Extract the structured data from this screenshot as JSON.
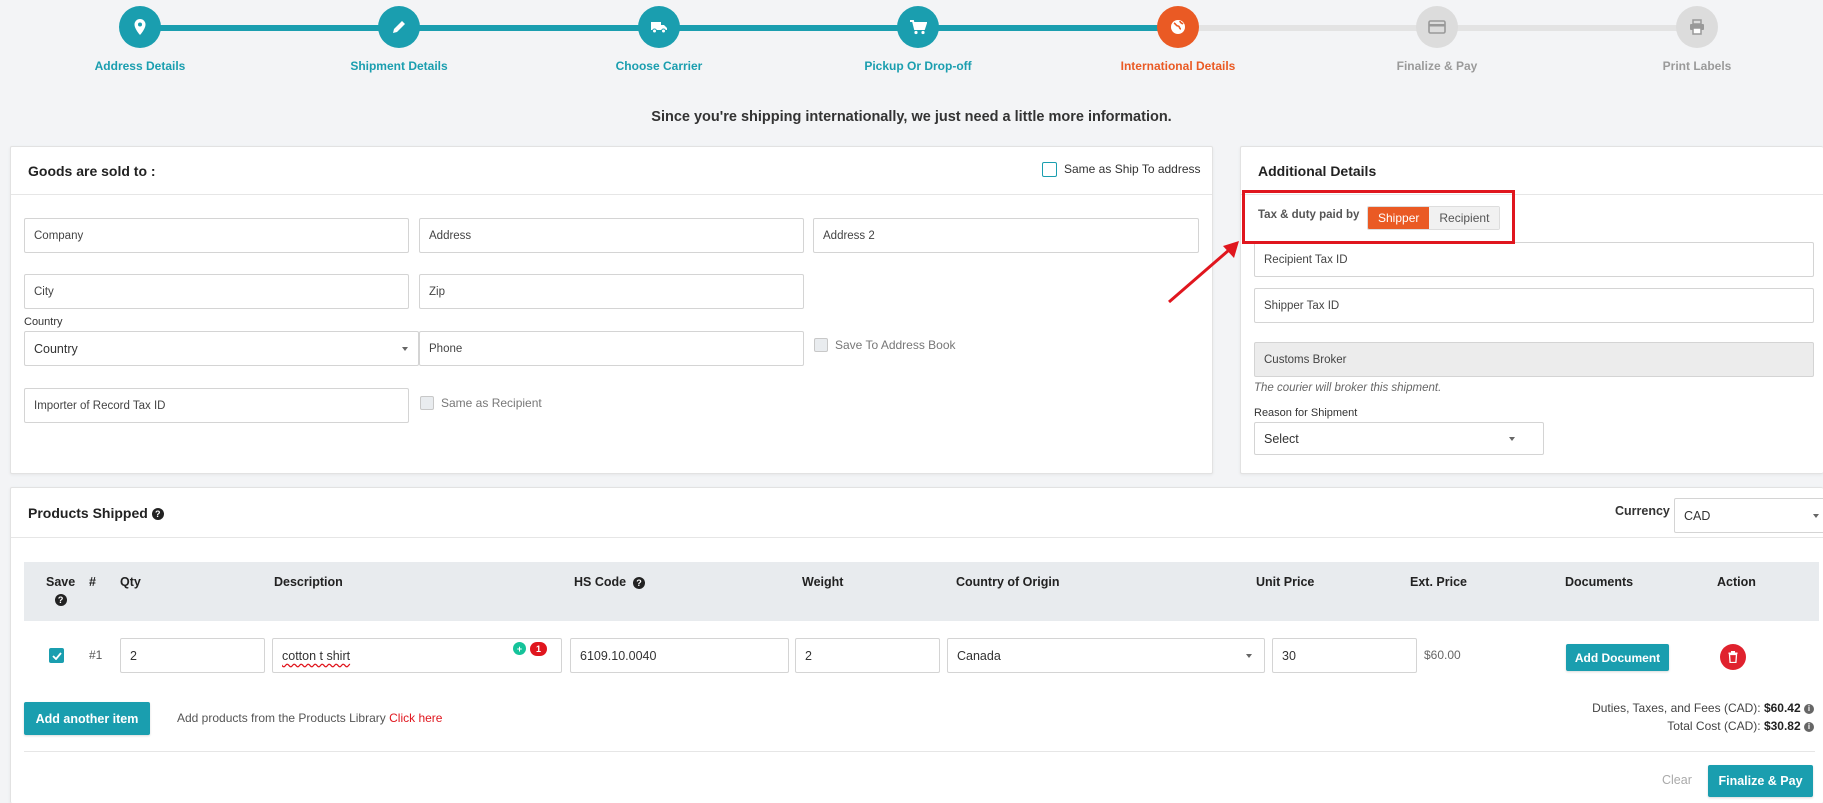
{
  "stepper": {
    "steps": [
      {
        "label": "Address Details"
      },
      {
        "label": "Shipment Details"
      },
      {
        "label": "Choose Carrier"
      },
      {
        "label": "Pickup Or Drop-off"
      },
      {
        "label": "International Details"
      },
      {
        "label": "Finalize & Pay"
      },
      {
        "label": "Print Labels"
      }
    ]
  },
  "intro": "Since you're shipping internationally, we just need a little more information.",
  "sold_to": {
    "title": "Goods are sold to :",
    "same_as_ship_label": "Same as Ship To address",
    "company": "Company",
    "address": "Address",
    "address2": "Address 2",
    "city": "City",
    "zip": "Zip",
    "country_label": "Country",
    "country_value": "Country",
    "phone": "Phone",
    "save_book_label": "Save To Address Book",
    "importer_tax": "Importer of Record Tax ID",
    "same_recipient_label": "Same as Recipient"
  },
  "additional": {
    "title": "Additional Details",
    "tax_label": "Tax & duty paid by",
    "opt_shipper": "Shipper",
    "opt_recipient": "Recipient",
    "recipient_tax": "Recipient Tax ID",
    "shipper_tax": "Shipper Tax ID",
    "customs_broker": "Customs Broker",
    "broker_note": "The courier will broker this shipment.",
    "reason_label": "Reason for Shipment",
    "reason_value": "Select"
  },
  "products": {
    "title": "Products Shipped",
    "currency_label": "Currency",
    "currency_value": "CAD",
    "headers": {
      "save": "Save",
      "num": "#",
      "qty": "Qty",
      "description": "Description",
      "hs_code": "HS Code",
      "weight": "Weight",
      "origin": "Country of Origin",
      "unit_price": "Unit Price",
      "ext_price": "Ext. Price",
      "documents": "Documents",
      "action": "Action"
    },
    "row": {
      "num": "#1",
      "qty": "2",
      "description": "cotton t shirt",
      "badge": "1",
      "hs_code": "6109.10.0040",
      "weight": "2",
      "origin": "Canada",
      "unit_price": "30",
      "ext_price": "$60.00",
      "add_document": "Add Document"
    },
    "add_item": "Add another item",
    "library_text": "Add products from the Products Library",
    "library_link": "Click here",
    "duties_label": "Duties, Taxes, and Fees (CAD):",
    "duties_value": "$60.42",
    "total_label": "Total Cost (CAD):",
    "total_value": "$30.82",
    "clear": "Clear",
    "finalize": "Finalize & Pay"
  }
}
